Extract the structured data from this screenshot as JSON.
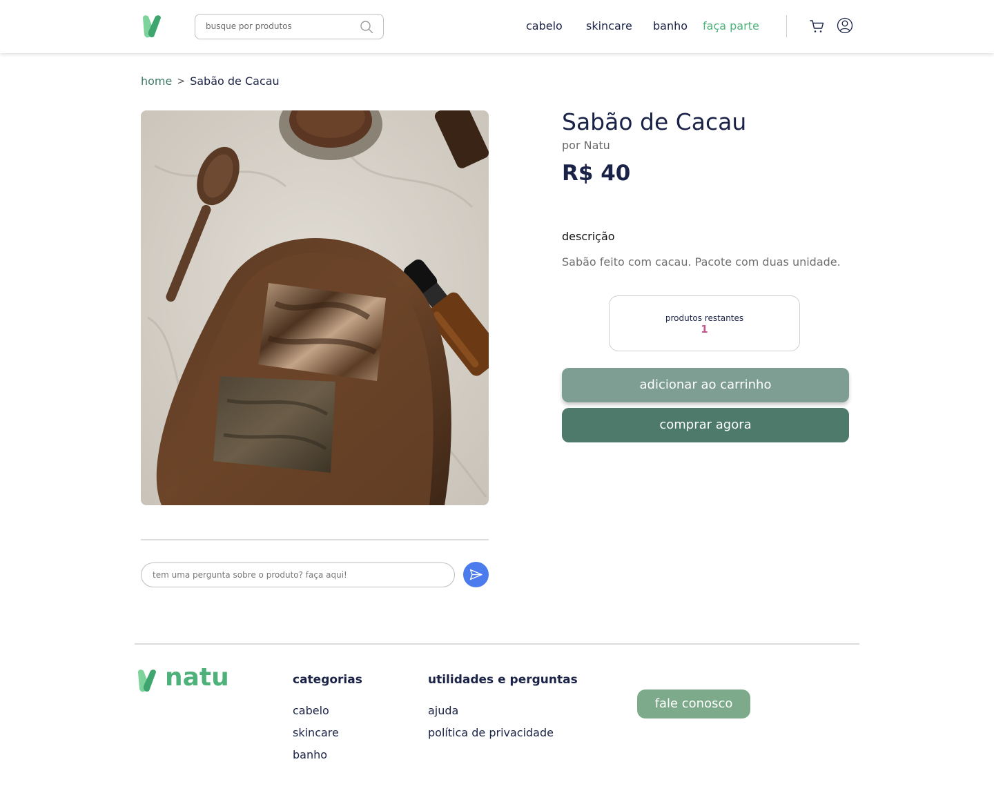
{
  "header": {
    "search_placeholder": "busque por produtos",
    "nav": {
      "cabelo": "cabelo",
      "skincare": "skincare",
      "banho": "banho",
      "join": "faça parte"
    }
  },
  "breadcrumb": {
    "home": "home",
    "separator": ">",
    "current": "Sabão de Cacau"
  },
  "product": {
    "title": "Sabão de Cacau",
    "brand": "por Natu",
    "price": "R$ 40",
    "description_label": "descrição",
    "description": "Sabão feito com cacau. Pacote com duas unidade.",
    "stock_label": "produtos restantes",
    "stock_value": "1",
    "add_to_cart": "adicionar ao carrinho",
    "buy_now": "comprar agora"
  },
  "question": {
    "placeholder": "tem uma pergunta sobre o produto? faça aqui!"
  },
  "footer": {
    "brand": "natu",
    "categories_heading": "categorias",
    "categories": [
      "cabelo",
      "skincare",
      "banho"
    ],
    "utilities_heading": "utilidades e perguntas",
    "utilities": [
      "ajuda",
      "política de privacidade"
    ],
    "contact_button": "fale conosco"
  },
  "colors": {
    "accent": "#4fb17a",
    "navy": "#1a2347",
    "cart_button": "#7e9e93",
    "buy_button": "#4d7a6b",
    "send_button": "#4b7bec",
    "stock_value": "#c0568e"
  },
  "icons": [
    "logo-icon",
    "search-icon",
    "cart-icon",
    "user-icon",
    "chevron-right-icon",
    "send-icon"
  ]
}
